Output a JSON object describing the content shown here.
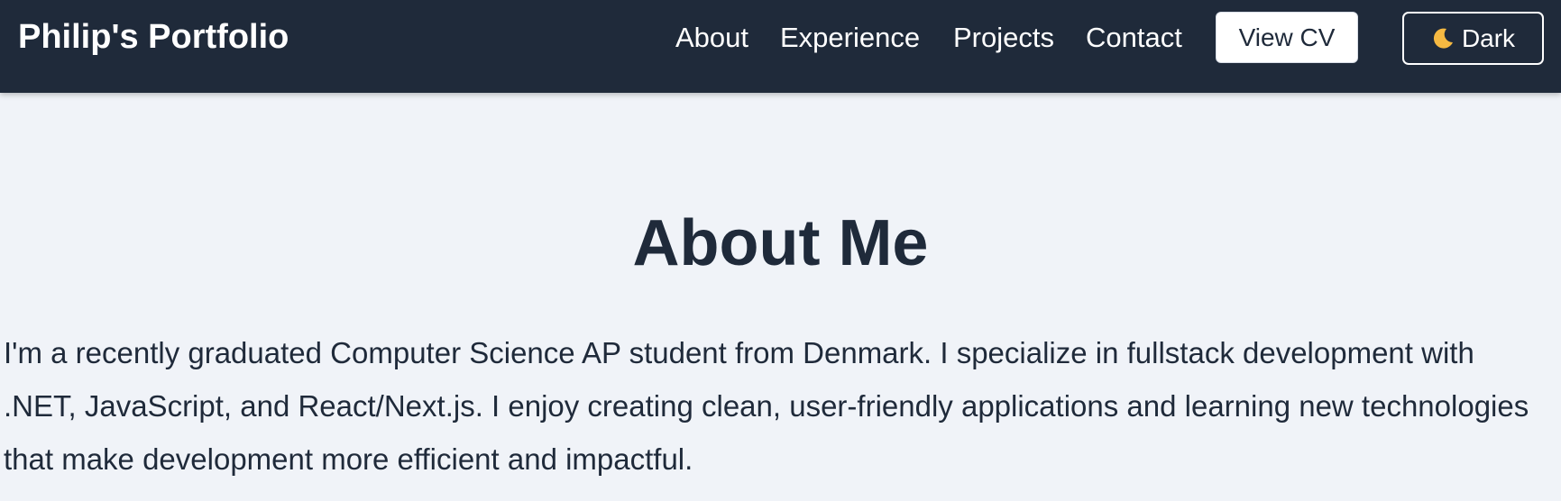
{
  "header": {
    "brand": "Philip's Portfolio",
    "nav": [
      "About",
      "Experience",
      "Projects",
      "Contact"
    ],
    "cv_button": "View CV",
    "theme_button": {
      "icon": "moon-icon",
      "label": "Dark"
    }
  },
  "about": {
    "title": "About Me",
    "text": "I'm a recently graduated Computer Science AP student from Denmark. I specialize in fullstack development with .NET, JavaScript, and React/Next.js. I enjoy creating clean, user-friendly applications and learning new technologies that make development more efficient and impactful."
  },
  "colors": {
    "navbar_bg": "#1f2a3a",
    "page_bg": "#f0f3f8",
    "text": "#1f2a3a",
    "moon": "#f5b942"
  }
}
